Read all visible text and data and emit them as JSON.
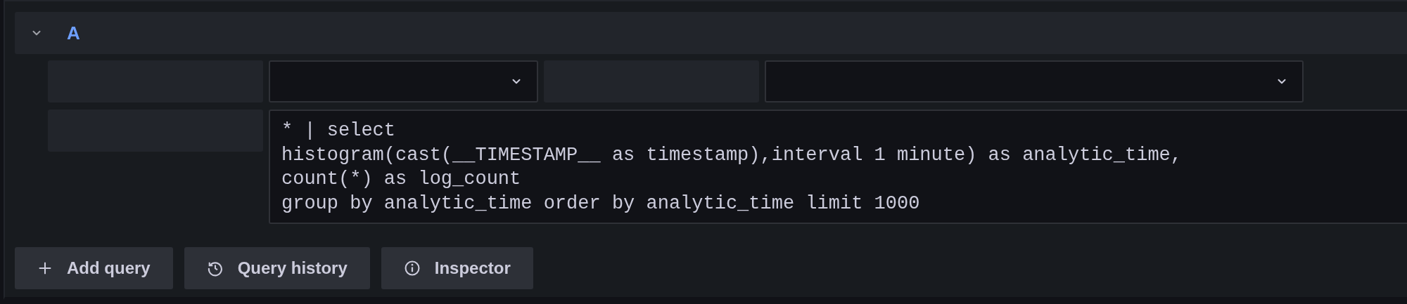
{
  "query": {
    "letter": "A",
    "expanded": true,
    "rows": [
      {
        "fields": [
          {
            "kind": "label"
          },
          {
            "kind": "select"
          },
          {
            "kind": "label"
          },
          {
            "kind": "select"
          }
        ]
      },
      {
        "fields": [
          {
            "kind": "label"
          },
          {
            "kind": "code",
            "lines": [
              "* | select",
              "histogram(cast(__TIMESTAMP__ as timestamp),interval 1 minute) as analytic_time,",
              "count(*) as log_count",
              "group by analytic_time order by analytic_time limit 1000"
            ]
          }
        ]
      }
    ]
  },
  "buttons": [
    {
      "kind": "add",
      "label": "Add query"
    },
    {
      "kind": "history",
      "label": "Query history"
    },
    {
      "kind": "info",
      "label": "Inspector"
    }
  ]
}
